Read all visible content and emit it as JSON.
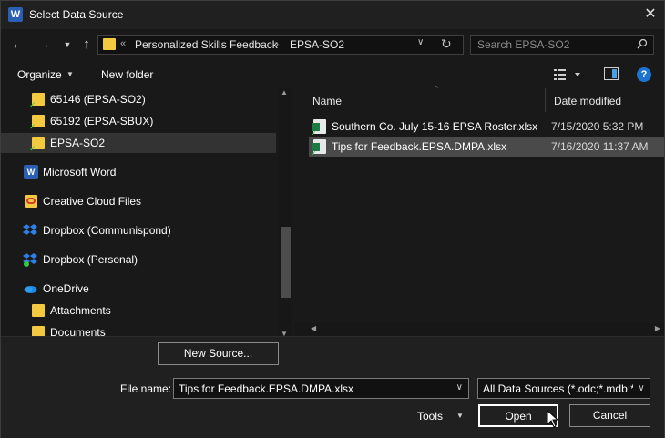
{
  "window": {
    "title": "Select Data Source",
    "app_icon_letter": "W",
    "close_glyph": "✕"
  },
  "address": {
    "overflow": "«",
    "segments": [
      "Personalized Skills Feedback",
      "EPSA-SO2"
    ],
    "separator": "›"
  },
  "search": {
    "placeholder": "Search EPSA-SO2"
  },
  "toolbar": {
    "organize": "Organize",
    "new_folder": "New folder",
    "help": "?"
  },
  "nav_pane": {
    "items": [
      {
        "label": "65146 (EPSA-SO2)",
        "icon": "folder-synced-icon"
      },
      {
        "label": "65192 (EPSA-SBUX)",
        "icon": "folder-synced-icon"
      },
      {
        "label": "EPSA-SO2",
        "icon": "folder-synced-icon",
        "selected": true
      },
      {
        "label": "Microsoft Word",
        "icon": "word-icon"
      },
      {
        "label": "Creative Cloud Files",
        "icon": "creative-cloud-icon"
      },
      {
        "label": "Dropbox (Communispond)",
        "icon": "dropbox-icon"
      },
      {
        "label": "Dropbox (Personal)",
        "icon": "dropbox-icon"
      },
      {
        "label": "OneDrive",
        "icon": "onedrive-icon"
      },
      {
        "label": "Attachments",
        "icon": "folder-icon"
      },
      {
        "label": "Documents",
        "icon": "folder-icon"
      }
    ]
  },
  "file_list": {
    "columns": [
      "Name",
      "Date modified"
    ],
    "files": [
      {
        "name": "Southern Co. July 15-16 EPSA Roster.xlsx",
        "date": "7/15/2020 5:32 PM",
        "selected": false
      },
      {
        "name": "Tips for Feedback.EPSA.DMPA.xlsx",
        "date": "7/16/2020 11:37 AM",
        "selected": true
      }
    ]
  },
  "bottom": {
    "new_source": "New Source...",
    "file_name_label": "File name:",
    "file_name_value": "Tips for Feedback.EPSA.DMPA.xlsx",
    "filter_value": "All Data Sources (*.odc;*.mdb;*",
    "tools": "Tools",
    "open": "Open",
    "cancel": "Cancel"
  },
  "colors": {
    "background": "#191919",
    "selection": "#4a4a4a",
    "folder": "#f3c93f",
    "accent": "#1b74d1"
  }
}
